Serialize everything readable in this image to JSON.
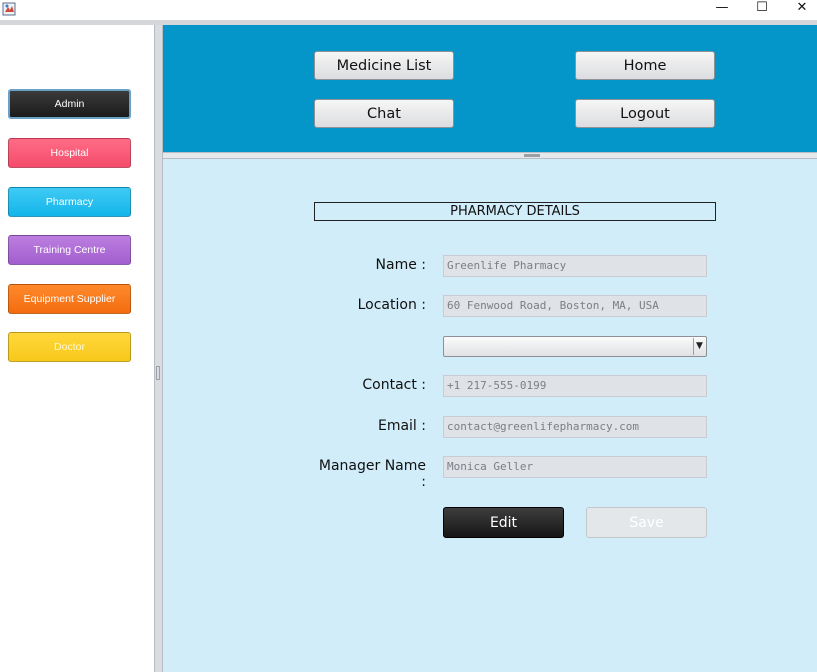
{
  "window": {
    "minimize_glyph": "—",
    "maximize_glyph": "☐",
    "close_glyph": "✕",
    "icon": "app-icon"
  },
  "sidebar": {
    "items": [
      {
        "label": "Admin",
        "color": "#1f1f1f"
      },
      {
        "label": "Hospital",
        "color": "#f7546f"
      },
      {
        "label": "Pharmacy",
        "color": "#1ab9ee"
      },
      {
        "label": "Training Centre",
        "color": "#aa68d6"
      },
      {
        "label": "Equipment Supplier",
        "color": "#f57317"
      },
      {
        "label": "Doctor",
        "color": "#f9cd22"
      }
    ]
  },
  "topnav": {
    "medicine_list": "Medicine List",
    "home": "Home",
    "chat": "Chat",
    "logout": "Logout",
    "background": "#0596c9"
  },
  "form": {
    "heading": "PHARMACY DETAILS",
    "name_label": "Name :",
    "name_value": "Greenlife Pharmacy",
    "location_label": "Location :",
    "location_value": "60 Fenwood Road, Boston, MA, USA",
    "dropdown_value": "",
    "contact_label": "Contact :",
    "contact_value": "+1 217-555-0199",
    "email_label": "Email :",
    "email_value": "contact@greenlifepharmacy.com",
    "manager_label": "Manager Name :",
    "manager_value": "Monica Geller",
    "edit_label": "Edit",
    "save_label": "Save",
    "background": "#d1edf9"
  }
}
